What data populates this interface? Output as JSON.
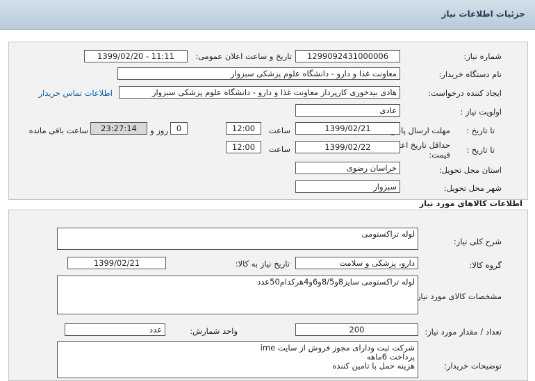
{
  "header": {
    "title": "جزئیات اطلاعات نیاز"
  },
  "info": {
    "need_number_label": "شماره نیاز:",
    "need_number": "1299092431000006",
    "announce_label": "تاریخ و ساعت اعلان عمومی:",
    "announce_value": "1399/02/20 - 11:11",
    "buyer_org_label": "نام دستگاه خریدار:",
    "buyer_org": "معاونت غذا و دارو - دانشگاه علوم پزشکی سبزوار",
    "creator_label": "ایجاد کننده درخواست:",
    "creator": "هادی بیدخوری کارپرداز معاونت غذا و دارو - دانشگاه علوم پزشکی سبزوار",
    "contact_link": "اطلاعات تماس خریدار",
    "priority_label": "اولویت نیاز :",
    "priority": "عادی",
    "deadline_label": "مهلت ارسال پاسخ:",
    "to_date_label": "تا تاریخ :",
    "deadline_date": "1399/02/21",
    "time_label": "ساعت",
    "deadline_time": "12:00",
    "days_value": "0",
    "days_label": "روز و",
    "remaining_time": "23:27:14",
    "remaining_label": "ساعت باقی مانده",
    "validity_label": "حداقل تاریخ اعتبار قیمت:",
    "validity_to_label": "تا تاریخ :",
    "validity_date": "1399/02/22",
    "validity_time_label": "ساعت",
    "validity_time": "12:00",
    "province_label": "استان محل تحویل:",
    "province": "خراسان رضوی",
    "city_label": "شهر محل تحویل:",
    "city": "سبزوار"
  },
  "goods": {
    "section_title": "اطلاعات کالاهای مورد نیاز",
    "summary_label": "شرح کلی نیاز:",
    "summary": "لوله تراکستومی",
    "group_label": "گروه کالا:",
    "group": "دارو، پزشکی و سلامت",
    "need_date_label": "تاریخ نیاز به کالا:",
    "need_date": "1399/02/21",
    "spec_label": "مشخصات کالای مورد نیاز:",
    "spec": "لوله تراکستومی سایز8و8/5و6و4هرکدام50عدد",
    "qty_label": "تعداد / مقدار مورد نیاز:",
    "qty": "200",
    "unit_label": "واحد شمارش:",
    "unit": "عدد",
    "notes_label": "توضیحات خریدار:",
    "notes": [
      "شرکت ثبت ودارای مجوز فروش از سایت ime",
      "پرداخت 6ماهه",
      "هزینه حمل با تامین کننده"
    ]
  }
}
